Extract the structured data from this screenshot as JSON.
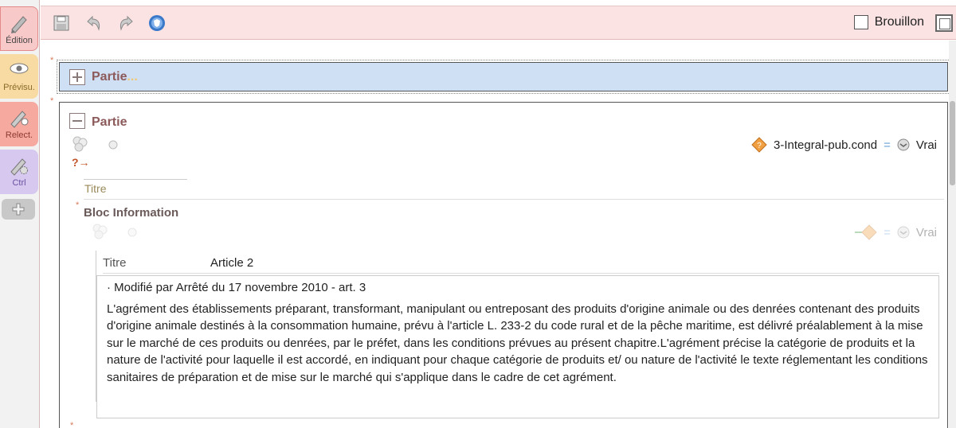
{
  "rail": {
    "tabs": [
      {
        "label": "Édition",
        "icon": "pencil-icon"
      },
      {
        "label": "Prévisu.",
        "icon": "eye-icon"
      },
      {
        "label": "Relect.",
        "icon": "review-pencil-icon"
      },
      {
        "label": "Ctrl",
        "icon": "gear-pencil-icon"
      }
    ],
    "add_icon": "plus-icon"
  },
  "toolbar": {
    "save_icon": "save-icon",
    "undo_icon": "undo-icon",
    "redo_icon": "redo-icon",
    "shield_icon": "shield-icon",
    "draft_label": "Brouillon",
    "draft_checked": false
  },
  "parts": [
    {
      "title": "Partie",
      "dots": "...",
      "expanded": false
    },
    {
      "title": "Partie",
      "expanded": true
    }
  ],
  "condition": {
    "name": "3-Integral-pub.cond",
    "operator": "=",
    "value": "Vrai"
  },
  "question_arrow": "?→",
  "field_titre": {
    "label": "Titre"
  },
  "bloc": {
    "title": "Bloc Information",
    "condition": {
      "operator": "=",
      "value": "Vrai"
    },
    "titre_label": "Titre",
    "titre_value": "Article 2",
    "paragraphs": [
      "· Modifié par Arrêté du 17 novembre 2010 - art. 3",
      "L'agrément des établissements préparant, transformant, manipulant ou entreposant des produits d'origine animale ou des denrées contenant des produits d'origine animale destinés à la consommation humaine, prévu à l'article L. 233-2 du code rural et de la pêche maritime, est délivré préalablement à la mise sur le marché de ces produits ou denrées, par le préfet, dans les conditions prévues au présent chapitre.L'agrément précise la catégorie de produits et la nature de l'activité pour laquelle il est accordé, en indiquant pour chaque catégorie de produits et/ ou nature de l'activité le texte réglementant les conditions sanitaires de préparation et de mise sur le marché qui s'applique dans le cadre de cet agrément."
    ]
  }
}
